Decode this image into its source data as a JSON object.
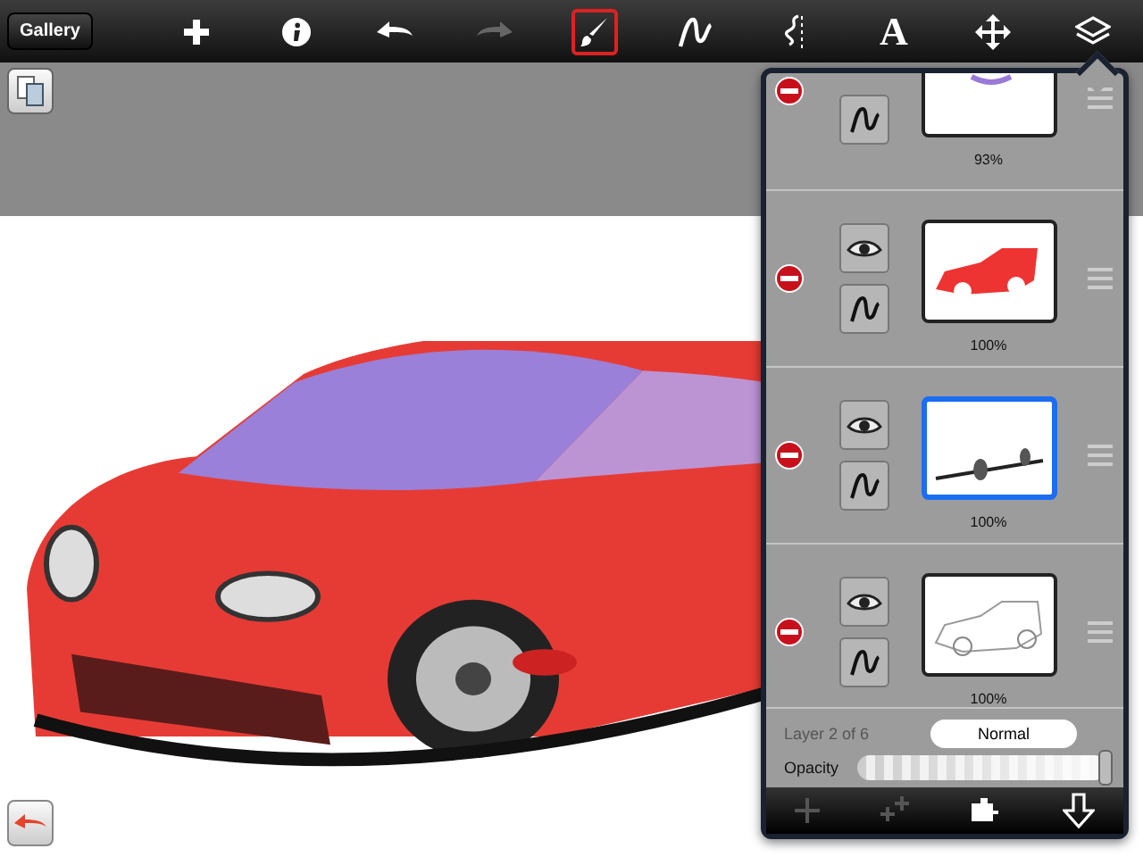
{
  "toolbar": {
    "gallery_button": "Gallery",
    "tools": [
      {
        "kind": "add",
        "selected": false,
        "disabled": false
      },
      {
        "kind": "info",
        "selected": false,
        "disabled": false
      },
      {
        "kind": "undo",
        "selected": false,
        "disabled": false
      },
      {
        "kind": "redo",
        "selected": false,
        "disabled": true
      },
      {
        "kind": "brush",
        "selected": true,
        "disabled": false
      },
      {
        "kind": "stroke",
        "selected": false,
        "disabled": false
      },
      {
        "kind": "ruler",
        "selected": false,
        "disabled": false
      },
      {
        "kind": "text",
        "label": "A",
        "selected": false,
        "disabled": false
      },
      {
        "kind": "move",
        "selected": false,
        "disabled": false
      },
      {
        "kind": "layers",
        "selected": false,
        "disabled": false
      }
    ]
  },
  "layers_panel": {
    "layers": [
      {
        "kind": "strokes",
        "opacity": "93%",
        "selected": false,
        "cut_off": true
      },
      {
        "kind": "car",
        "opacity": "100%",
        "selected": false,
        "cut_off": false
      },
      {
        "kind": "wheels",
        "opacity": "100%",
        "selected": true,
        "cut_off": false
      },
      {
        "kind": "outline",
        "opacity": "100%",
        "selected": false,
        "cut_off": false
      }
    ],
    "layer_info": "Layer 2 of 6",
    "blend_mode": "Normal",
    "opacity_label": "Opacity",
    "opacity": {
      "level": 0.97
    },
    "footer": [
      {
        "kind": "add",
        "disabled": true
      },
      {
        "kind": "duplicate",
        "disabled": true
      },
      {
        "kind": "merge",
        "disabled": false
      },
      {
        "kind": "move-down",
        "disabled": false
      }
    ]
  }
}
